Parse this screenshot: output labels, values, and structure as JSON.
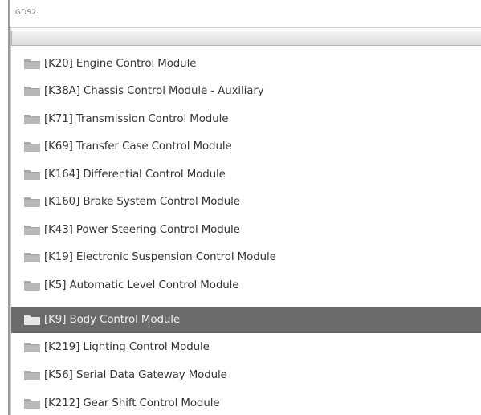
{
  "window": {
    "title": "GDS2"
  },
  "modules": [
    {
      "label": "[K20] Engine Control Module",
      "selected": false,
      "icon": "folder-icon"
    },
    {
      "label": "[K38A] Chassis Control Module - Auxiliary",
      "selected": false,
      "icon": "folder-icon"
    },
    {
      "label": "[K71] Transmission Control Module",
      "selected": false,
      "icon": "folder-icon"
    },
    {
      "label": "[K69] Transfer Case Control Module",
      "selected": false,
      "icon": "folder-icon"
    },
    {
      "label": "[K164] Differential Control Module",
      "selected": false,
      "icon": "folder-icon"
    },
    {
      "label": "[K160] Brake System Control Module",
      "selected": false,
      "icon": "folder-icon"
    },
    {
      "label": "[K43] Power Steering Control Module",
      "selected": false,
      "icon": "folder-icon"
    },
    {
      "label": "[K19] Electronic Suspension Control Module",
      "selected": false,
      "icon": "folder-icon"
    },
    {
      "label": "[K5] Automatic Level Control Module",
      "selected": false,
      "icon": "folder-icon"
    },
    {
      "label": "[K9] Body Control Module",
      "selected": true,
      "icon": "folder-icon"
    },
    {
      "label": "[K219] Lighting Control Module",
      "selected": false,
      "icon": "folder-icon"
    },
    {
      "label": "[K56] Serial Data Gateway Module",
      "selected": false,
      "icon": "folder-icon"
    },
    {
      "label": "[K212] Gear Shift Control Module",
      "selected": false,
      "icon": "folder-icon"
    }
  ],
  "colors": {
    "selection": "#6b6b6b",
    "folder": "#b8b8b8",
    "folder_selected": "#e6e6e6"
  }
}
